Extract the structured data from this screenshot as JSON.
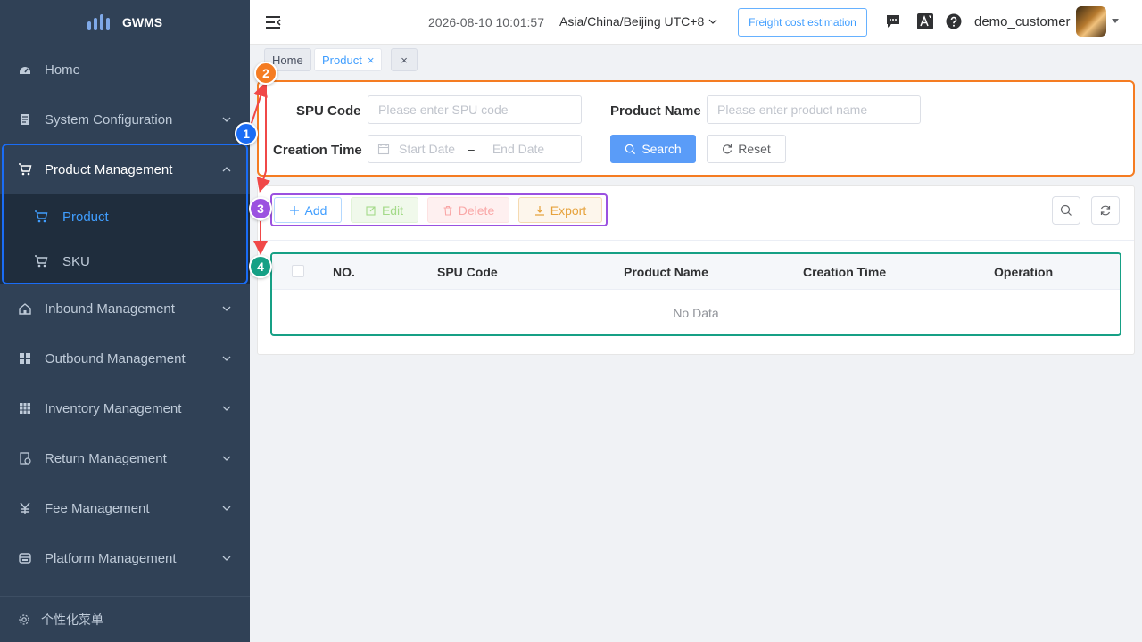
{
  "app": {
    "name": "GWMS"
  },
  "sidebar": {
    "items": [
      {
        "label": "Home",
        "icon": "dashboard-icon"
      },
      {
        "label": "System Configuration",
        "icon": "document-icon"
      },
      {
        "label": "Product Management",
        "icon": "cart-icon",
        "expanded": true
      },
      {
        "label": "Inbound Management",
        "icon": "home-icon"
      },
      {
        "label": "Outbound Management",
        "icon": "grid-icon"
      },
      {
        "label": "Inventory Management",
        "icon": "table-icon"
      },
      {
        "label": "Return Management",
        "icon": "return-icon"
      },
      {
        "label": "Fee Management",
        "icon": "yen-icon"
      },
      {
        "label": "Platform Management",
        "icon": "platform-icon"
      }
    ],
    "sub_items": [
      {
        "label": "Product",
        "active": true
      },
      {
        "label": "SKU",
        "active": false
      }
    ],
    "footer": "个性化菜单"
  },
  "header": {
    "datetime": "2026-08-10 10:01:57",
    "timezone": "Asia/China/Beijing UTC+8",
    "freight_btn": "Freight cost estimation",
    "username": "demo_customer"
  },
  "tags": [
    {
      "label": "Home",
      "active": false
    },
    {
      "label": "Product",
      "active": true
    }
  ],
  "search": {
    "spu_label": "SPU Code",
    "spu_placeholder": "Please enter SPU code",
    "name_label": "Product Name",
    "name_placeholder": "Please enter product name",
    "time_label": "Creation Time",
    "start_placeholder": "Start Date",
    "range_sep": "–",
    "end_placeholder": "End Date",
    "search_btn": "Search",
    "reset_btn": "Reset"
  },
  "toolbar": {
    "add": "Add",
    "edit": "Edit",
    "delete": "Delete",
    "export": "Export"
  },
  "table": {
    "columns": [
      "NO.",
      "SPU Code",
      "Product Name",
      "Creation Time",
      "Operation"
    ],
    "empty": "No Data"
  },
  "annotations": [
    {
      "label": "1",
      "color": "#1a6cf5"
    },
    {
      "label": "2",
      "color": "#f57c22"
    },
    {
      "label": "3",
      "color": "#9b51e0"
    },
    {
      "label": "4",
      "color": "#16a085"
    }
  ],
  "colors": {
    "sidebar_bg": "#304156",
    "accent": "#409eff",
    "annotation_arrow": "#f04848"
  }
}
